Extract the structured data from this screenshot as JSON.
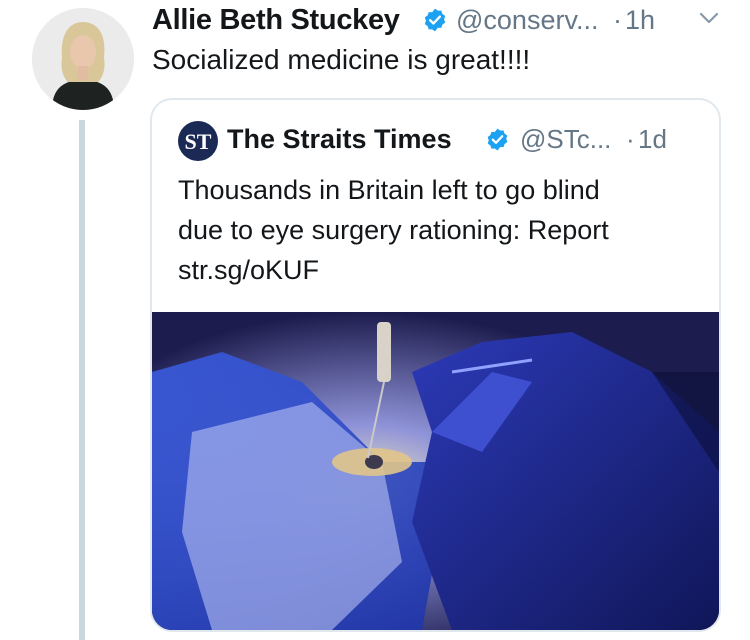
{
  "tweet": {
    "author_name": "Allie Beth Stuckey",
    "handle": "@conserv...",
    "separator": "·",
    "time": "1h",
    "text": "Socialized medicine is great!!!!"
  },
  "quoted_tweet": {
    "author_name": "The Straits Times",
    "handle": "@STc...",
    "separator": "·",
    "time": "1d",
    "text_lines": [
      "Thousands in Britain left to go blind",
      "due to eye surgery rationing: Report",
      "str.sg/oKUF"
    ]
  },
  "colors": {
    "text": "#14171a",
    "secondary": "#657786",
    "verified": "#1da1f2",
    "border": "#e1e8ed",
    "thread_line": "#ccd6dd"
  },
  "icons": {
    "verified": "verified-badge-icon",
    "chevron": "chevron-down-icon",
    "publisher_logo": "straits-times-logo"
  }
}
